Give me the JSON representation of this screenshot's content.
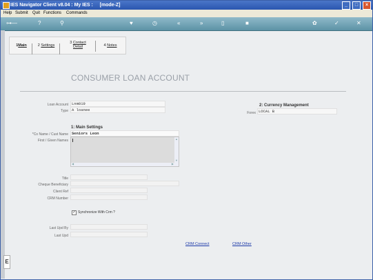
{
  "window": {
    "title": "IES Navigator Client v8.04 : My IES :",
    "mode": "[mode-Z]",
    "controls": [
      "_",
      "□",
      "×"
    ]
  },
  "menu": [
    "Help",
    "Submit",
    "Quit",
    "Functions",
    "Commands"
  ],
  "toolbar": {
    "icons": [
      "key-icon",
      "help-icon",
      "search-icon",
      "heart-icon",
      "clock-icon",
      "rewind-icon",
      "fast-forward-icon",
      "page-icon",
      "stop-icon",
      "tools-icon",
      "check-icon",
      "close-icon"
    ]
  },
  "tabs": [
    {
      "num": "1",
      "label": "Main"
    },
    {
      "num": "2",
      "label": "Settings"
    },
    {
      "num": "3",
      "label": "Contact\nDetail"
    },
    {
      "num": "4",
      "label": "Notes"
    }
  ],
  "page": {
    "title": "CONSUMER LOAN ACCOUNT"
  },
  "form": {
    "loan_account_label": "Loan Account",
    "loan_account_value": "Lnm019",
    "type_label": "Type",
    "type_value": "A loanee",
    "main_settings_title": "1: Main Settings",
    "co_name_label": "*Co Name / Cust Name",
    "co_name_value": "Seniors Leon",
    "first_names_label": "First / Given Names",
    "title_label": "Title",
    "cheque_beneficiary_label": "Cheque Beneficiary",
    "client_ref_label": "Client Ref",
    "crm_number_label": "CRM Number",
    "sync_crm_label": "Synchronize With Crm ?",
    "sync_crm_checked": "✓",
    "last_upd_by_label": "Last Upd By",
    "last_upd_label": "Last Upd",
    "currency_title": "2: Currency Management",
    "forex_label": "Forex",
    "forex_value": "LOCAL B"
  },
  "links": {
    "crm_connect": "CRM Connect",
    "crm_other": "CRM Other"
  },
  "sidebar": {
    "icon_text": "E"
  },
  "colors": {
    "title_bar": "#2a56b0",
    "toolbar": "#6fa3b5",
    "link": "#1b38a8"
  }
}
